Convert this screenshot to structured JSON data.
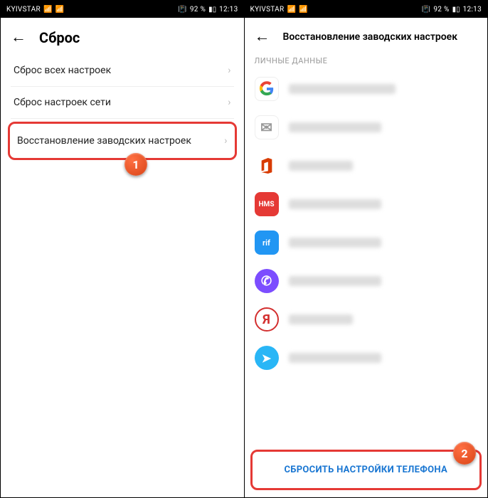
{
  "statusBar": {
    "carrier": "KYIVSTAR",
    "battery": "92 %",
    "time": "12:13",
    "vibrate": "📳"
  },
  "left": {
    "headerTitle": "Сброс",
    "items": [
      {
        "label": "Сброс всех настроек"
      },
      {
        "label": "Сброс настроек сети"
      },
      {
        "label": "Восстановление заводских настроек"
      }
    ],
    "stepBadge": "1"
  },
  "right": {
    "headerTitle": "Восстановление заводских настроек",
    "sectionLabel": "ЛИЧНЫЕ ДАННЫЕ",
    "accounts": [
      {
        "icon": "google"
      },
      {
        "icon": "mail"
      },
      {
        "icon": "office"
      },
      {
        "icon": "hms",
        "text": "HMS"
      },
      {
        "icon": "rif",
        "text": "rif"
      },
      {
        "icon": "viber"
      },
      {
        "icon": "yandex",
        "text": "Я"
      },
      {
        "icon": "telegram"
      }
    ],
    "resetButton": "СБРОСИТЬ НАСТРОЙКИ ТЕЛЕФОНА",
    "stepBadge": "2"
  }
}
